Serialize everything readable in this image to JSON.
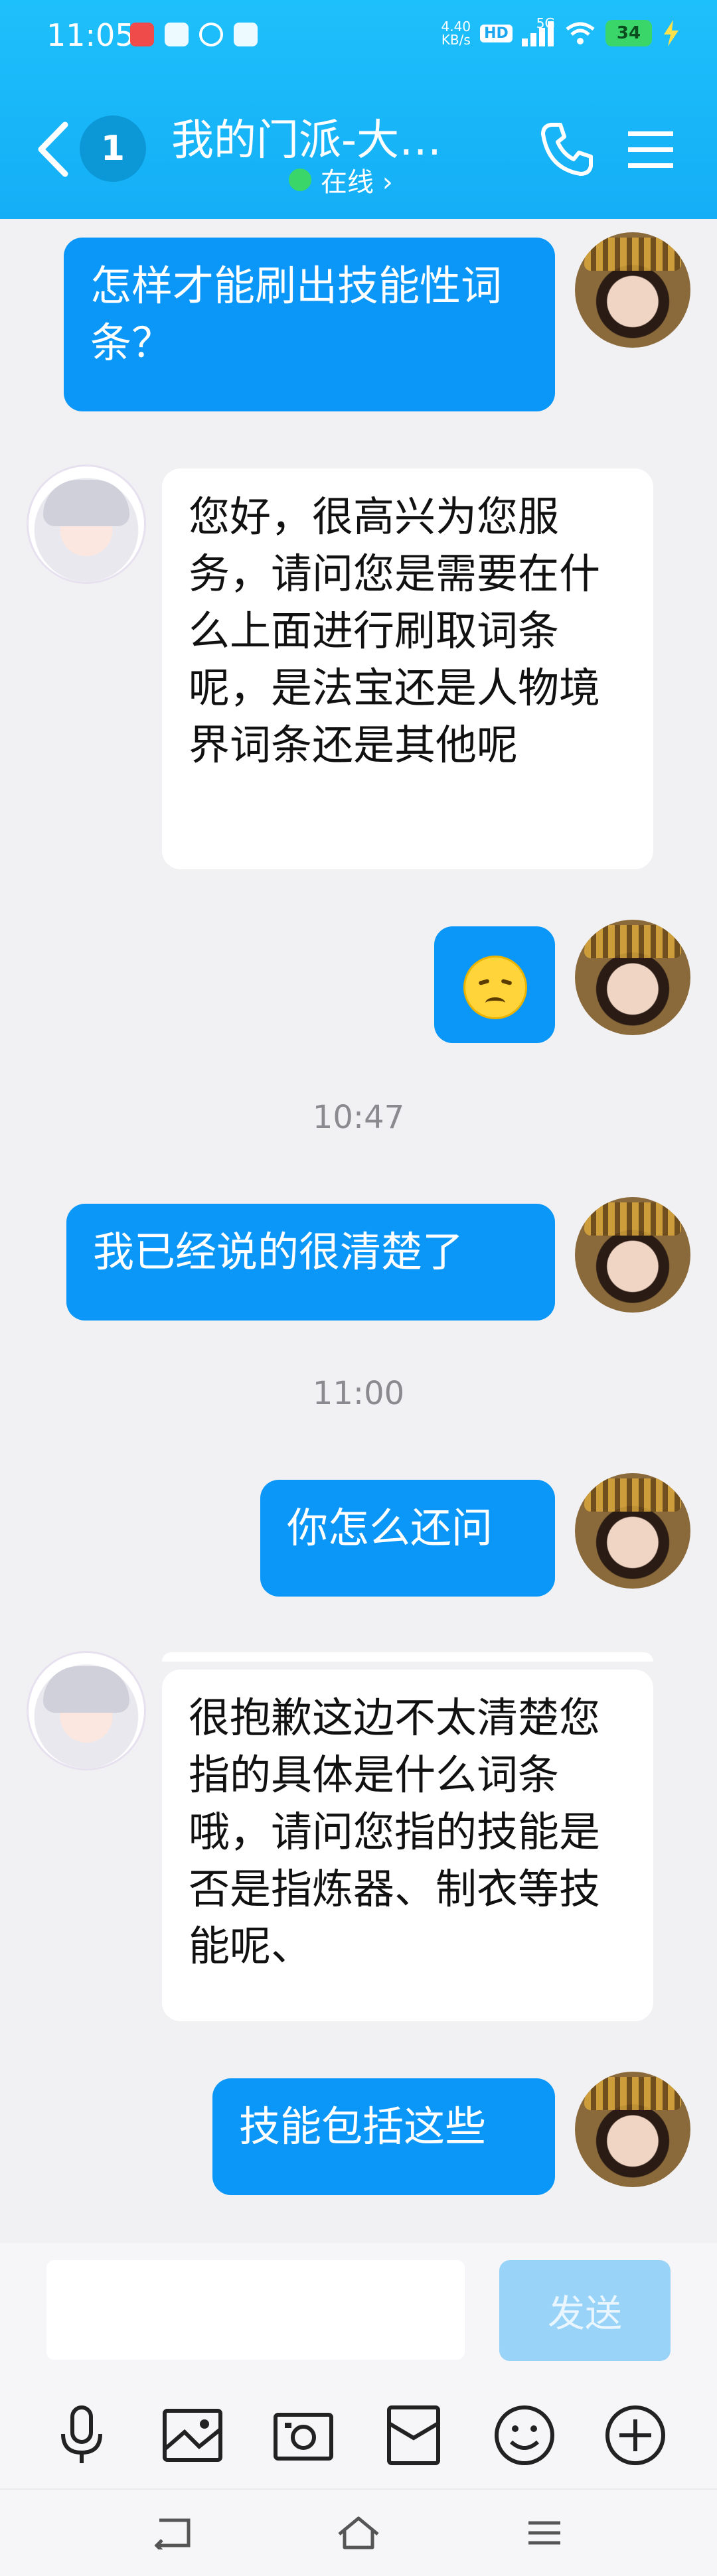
{
  "status_bar": {
    "time": "11:05",
    "net_speed_top": "4.40",
    "net_speed_unit": "KB/s",
    "hd_label": "HD",
    "network": "5G",
    "battery": "34"
  },
  "header": {
    "unread_count": "1",
    "title": "我的门派-大…",
    "status": "在线 ›"
  },
  "messages": {
    "m1": "怎样才能刷出技能性词条？",
    "m2": "您好，很高兴为您服务，请问您是需要在什么上面进行刷取词条呢，是法宝还是人物境界词条还是其他呢",
    "ts1": "10:47",
    "m4": "我已经说的很清楚了",
    "ts2": "11:00",
    "m5": "你怎么还问",
    "m6": "很抱歉这边不太清楚您指的具体是什么词条哦，请问您指的技能是否是指炼器、制衣等技能呢、",
    "m7": "技能包括这些"
  },
  "composer": {
    "placeholder": "",
    "send_label": "发送"
  },
  "colors": {
    "header": "#14aef6",
    "my_bubble": "#0a97f7",
    "their_bubble": "#ffffff",
    "send_disabled": "#9ad3f8"
  }
}
